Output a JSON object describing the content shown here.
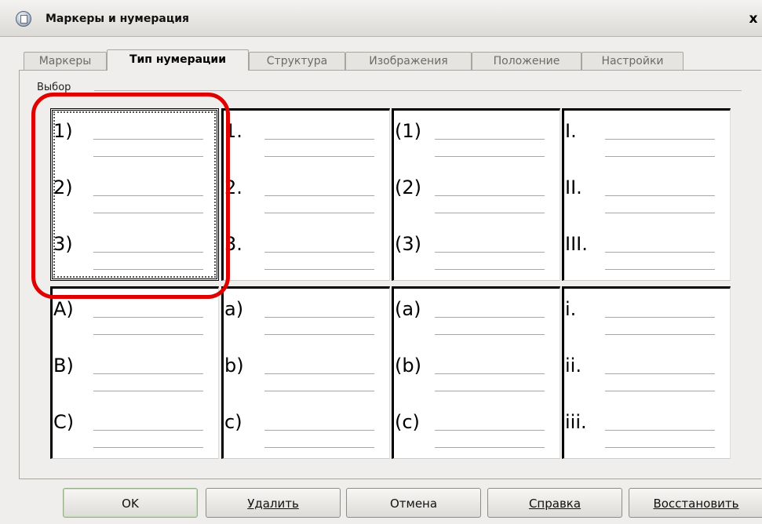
{
  "window": {
    "title": "Маркеры и нумерация",
    "close_label": "x"
  },
  "tabs": [
    {
      "label": "Маркеры",
      "active": false
    },
    {
      "label": "Тип нумерации",
      "active": true
    },
    {
      "label": "Структура",
      "active": false
    },
    {
      "label": "Изображения",
      "active": false
    },
    {
      "label": "Положение",
      "active": false
    },
    {
      "label": "Настройки",
      "active": false
    }
  ],
  "group_label": "Выбор",
  "presets": [
    {
      "markers": [
        "1)",
        "2)",
        "3)"
      ],
      "selected": true
    },
    {
      "markers": [
        "1.",
        "2.",
        "3."
      ],
      "selected": false
    },
    {
      "markers": [
        "(1)",
        "(2)",
        "(3)"
      ],
      "selected": false
    },
    {
      "markers": [
        "I.",
        "II.",
        "III."
      ],
      "selected": false
    },
    {
      "markers": [
        "A)",
        "B)",
        "C)"
      ],
      "selected": false
    },
    {
      "markers": [
        "a)",
        "b)",
        "c)"
      ],
      "selected": false
    },
    {
      "markers": [
        "(a)",
        "(b)",
        "(c)"
      ],
      "selected": false
    },
    {
      "markers": [
        "i.",
        "ii.",
        "iii."
      ],
      "selected": false
    }
  ],
  "buttons": {
    "ok": "OK",
    "delete": "Удалить",
    "cancel": "Отмена",
    "help": "Справка",
    "reset": "Восстановить"
  }
}
